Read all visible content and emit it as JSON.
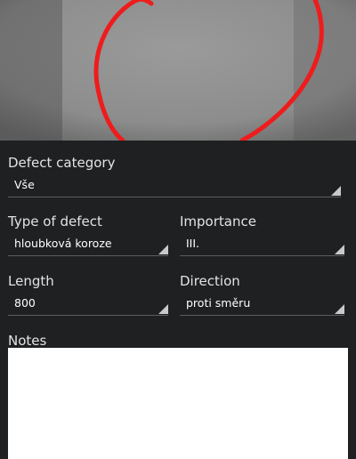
{
  "photo": {
    "annotation_color": "#ee1c1c",
    "background_color": "#8f908f"
  },
  "form": {
    "defect_category": {
      "label": "Defect category",
      "value": "Vše"
    },
    "type_of_defect": {
      "label": "Type of defect",
      "value": "hloubková koroze"
    },
    "importance": {
      "label": "Importance",
      "value": "III."
    },
    "length": {
      "label": "Length",
      "value": "800"
    },
    "direction": {
      "label": "Direction",
      "value": "proti směru"
    },
    "notes": {
      "label": "Notes",
      "value": ""
    }
  },
  "colors": {
    "background": "#1e2022",
    "underline": "#5a5c5f",
    "arrow": "#c9c9c9"
  }
}
